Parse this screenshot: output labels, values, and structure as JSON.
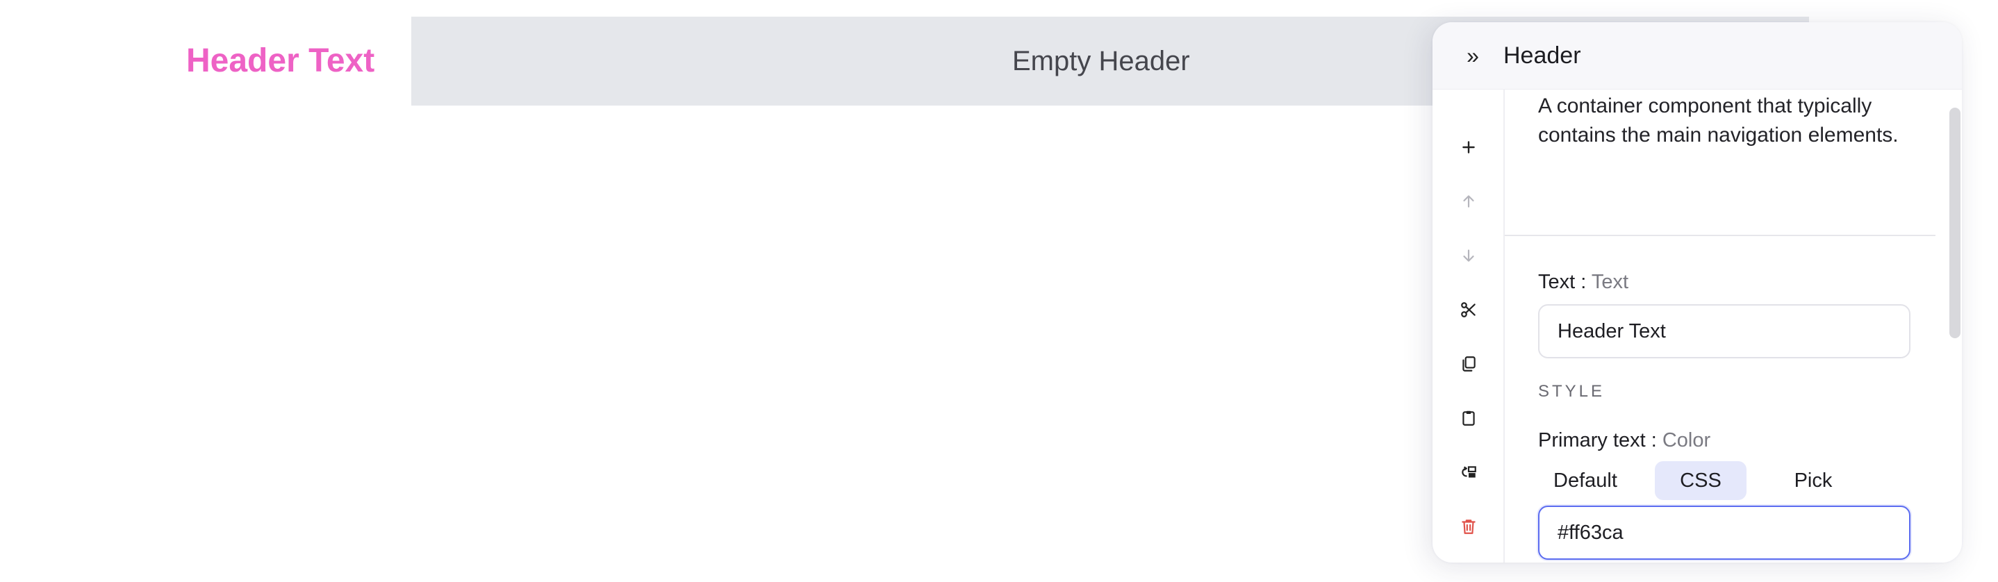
{
  "canvas": {
    "header_text": "Header Text",
    "empty_header_label": "Empty Header"
  },
  "panel": {
    "collapse_glyph": "»",
    "title": "Header",
    "description": "A container component that typically contains the main navigation elements.",
    "toolbar": [
      {
        "name": "plus-icon",
        "color": "#222222"
      },
      {
        "name": "arrow-up-icon",
        "color": "#b5b5bc"
      },
      {
        "name": "arrow-down-icon",
        "color": "#b5b5bc"
      },
      {
        "name": "scissors-icon",
        "color": "#222222"
      },
      {
        "name": "copy-icon",
        "color": "#222222"
      },
      {
        "name": "clipboard-icon",
        "color": "#222222"
      },
      {
        "name": "replace-icon",
        "color": "#222222"
      },
      {
        "name": "trash-icon",
        "color": "#e0524a"
      }
    ],
    "text_field": {
      "label": "Text",
      "separator": " : ",
      "type": "Text",
      "value": "Header Text"
    },
    "style_section": "STYLE",
    "color_field": {
      "label": "Primary text",
      "separator": " : ",
      "type": "Color",
      "options": [
        "Default",
        "CSS",
        "Pick"
      ],
      "selected": "CSS",
      "value": "#ff63ca"
    }
  },
  "colors": {
    "accent_pink": "#ee62c5",
    "focus_blue": "#5b6cf0",
    "segment_active": "#e5e8fb"
  }
}
